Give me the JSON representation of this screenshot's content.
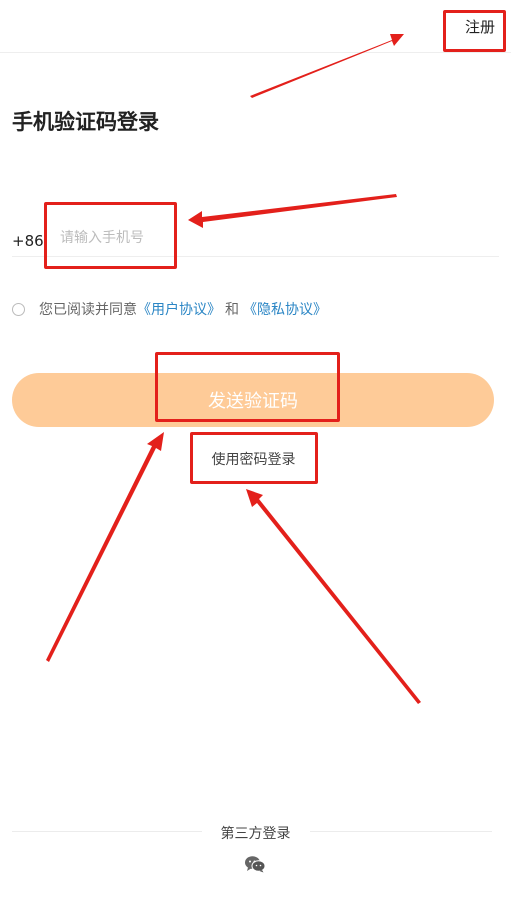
{
  "header": {
    "register_label": "注册"
  },
  "main": {
    "title": "手机验证码登录",
    "phone": {
      "country_code": "+86",
      "placeholder": "请输入手机号",
      "value": ""
    },
    "agreement": {
      "prefix": "您已阅读并同意",
      "user_agreement": "《用户协议》",
      "and": "和",
      "privacy_agreement": "《隐私协议》"
    },
    "send_code_label": "发送验证码",
    "password_login_label": "使用密码登录"
  },
  "third_party": {
    "label": "第三方登录",
    "icon": "wechat-icon"
  },
  "colors": {
    "button_bg": "#fecb98",
    "link": "#2b86c5",
    "annotation": "#e3201b"
  }
}
